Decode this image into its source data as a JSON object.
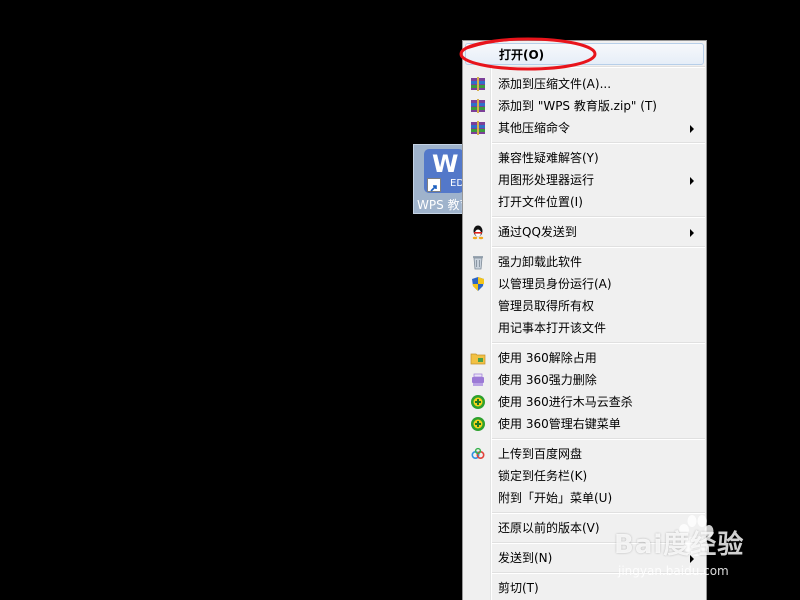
{
  "desktop": {
    "icon_label": "WPS 教育",
    "icon_badge": "ED",
    "icon_letter": "W"
  },
  "context_menu": {
    "items": [
      {
        "label": "打开(O)",
        "bold": true,
        "icon": "",
        "submenu": false
      },
      {
        "label": "添加到压缩文件(A)...",
        "icon": "winrar-archive-icon",
        "submenu": false
      },
      {
        "label": "添加到 \"WPS 教育版.zip\" (T)",
        "icon": "winrar-archive-icon",
        "submenu": false
      },
      {
        "label": "其他压缩命令",
        "icon": "winrar-archive-icon",
        "submenu": true
      },
      {
        "label": "兼容性疑难解答(Y)",
        "icon": "",
        "submenu": false
      },
      {
        "label": "用图形处理器运行",
        "icon": "",
        "submenu": true
      },
      {
        "label": "打开文件位置(I)",
        "icon": "",
        "submenu": false
      },
      {
        "label": "通过QQ发送到",
        "icon": "qq-penguin-icon",
        "submenu": true
      },
      {
        "label": "强力卸载此软件",
        "icon": "trash-bin-icon",
        "submenu": false
      },
      {
        "label": "以管理员身份运行(A)",
        "icon": "uac-shield-icon",
        "submenu": false
      },
      {
        "label": "管理员取得所有权",
        "icon": "",
        "submenu": false
      },
      {
        "label": "用记事本打开该文件",
        "icon": "",
        "submenu": false
      },
      {
        "label": "使用 360解除占用",
        "icon": "folder-unlock-icon",
        "submenu": false
      },
      {
        "label": "使用 360强力删除",
        "icon": "shredder-icon",
        "submenu": false
      },
      {
        "label": "使用 360进行木马云查杀",
        "icon": "360-security-icon",
        "submenu": false
      },
      {
        "label": "使用 360管理右键菜单",
        "icon": "360-security-icon",
        "submenu": false
      },
      {
        "label": "上传到百度网盘",
        "icon": "baidu-cloud-icon",
        "submenu": false
      },
      {
        "label": "锁定到任务栏(K)",
        "icon": "",
        "submenu": false
      },
      {
        "label": "附到「开始」菜单(U)",
        "icon": "",
        "submenu": false
      },
      {
        "label": "还原以前的版本(V)",
        "icon": "",
        "submenu": false
      },
      {
        "label": "发送到(N)",
        "icon": "",
        "submenu": true
      },
      {
        "label": "剪切(T)",
        "icon": "",
        "submenu": false
      }
    ]
  },
  "watermark": {
    "main": "Bai度经验",
    "sub": "jingyan.baidu.com"
  },
  "colors": {
    "annotation": "#e8141b",
    "menu_bg": "#f0f0f0",
    "desktop_bg": "#000000"
  }
}
